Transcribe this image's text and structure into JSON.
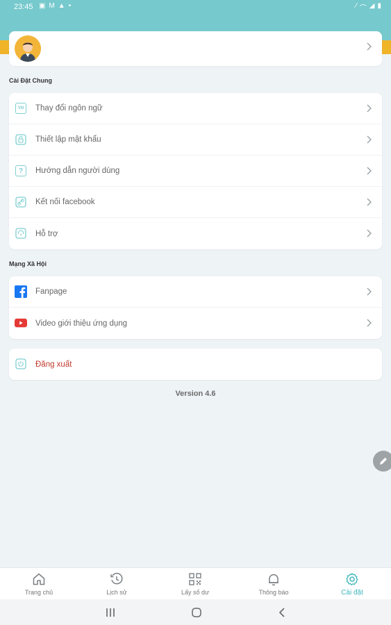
{
  "status_bar": {
    "time": "23:45",
    "left_icons": [
      "image-icon",
      "mail-icon",
      "alert-icon",
      "dot-icon"
    ],
    "right_icons": [
      "mute-icon",
      "wifi-icon",
      "signal-icon",
      "battery-icon"
    ]
  },
  "sections": {
    "general_title": "Cài Đặt Chung",
    "social_title": "Mạng Xã Hội"
  },
  "general_items": [
    {
      "label": "Thay đổi ngôn ngữ",
      "icon": "language-icon",
      "icon_text": "VN"
    },
    {
      "label": "Thiết lập mật khẩu",
      "icon": "lock-icon"
    },
    {
      "label": "Hướng dẫn người dùng",
      "icon": "help-icon",
      "icon_text": "?"
    },
    {
      "label": "Kết nối facebook",
      "icon": "link-icon"
    },
    {
      "label": "Hỗ trợ",
      "icon": "support-icon"
    }
  ],
  "social_items": [
    {
      "label": "Fanpage",
      "icon": "facebook-icon"
    },
    {
      "label": "Video giới thiệu ứng dụng",
      "icon": "youtube-icon"
    }
  ],
  "logout": {
    "label": "Đăng xuất",
    "icon": "power-icon"
  },
  "version": "Version 4.6",
  "bottom_nav": [
    {
      "label": "Trang chủ",
      "icon": "home-icon"
    },
    {
      "label": "Lịch sử",
      "icon": "history-icon"
    },
    {
      "label": "Lấy số dư",
      "icon": "qr-icon"
    },
    {
      "label": "Thông báo",
      "icon": "bell-icon"
    },
    {
      "label": "Cài đặt",
      "icon": "gear-icon",
      "active": true
    }
  ],
  "colors": {
    "header": "#76c9cd",
    "accent": "#3fb7bd",
    "logout": "#c0392b",
    "facebook": "#1877f2",
    "youtube": "#e53935"
  }
}
